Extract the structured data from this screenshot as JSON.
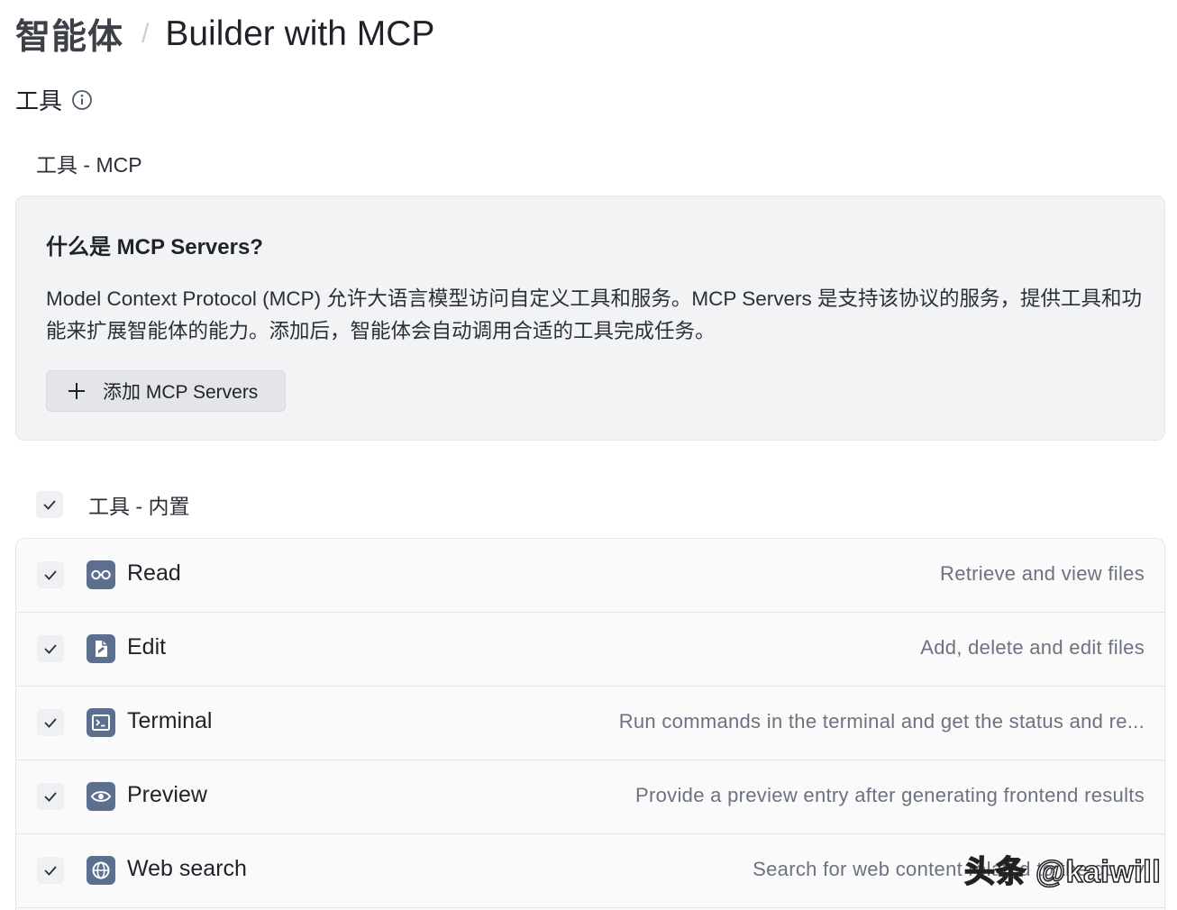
{
  "breadcrumb": {
    "root": "智能体",
    "separator": "/",
    "current": "Builder with MCP"
  },
  "tools_section": {
    "title": "工具",
    "info_icon": "info-circle-icon"
  },
  "mcp": {
    "subtitle": "工具 - MCP",
    "card_title": "什么是 MCP Servers?",
    "card_desc": "Model Context Protocol (MCP) 允许大语言模型访问自定义工具和服务。MCP Servers 是支持该协议的服务，提供工具和功能来扩展智能体的能力。添加后，智能体会自动调用合适的工具完成任务。",
    "add_button": "添加 MCP Servers"
  },
  "builtin": {
    "label": "工具 - 内置",
    "checked": true,
    "tools": [
      {
        "name": "Read",
        "desc": "Retrieve and view files",
        "icon": "glasses-icon",
        "checked": true
      },
      {
        "name": "Edit",
        "desc": "Add, delete and edit files",
        "icon": "edit-file-icon",
        "checked": true
      },
      {
        "name": "Terminal",
        "desc": "Run commands in the terminal and get the status and re...",
        "icon": "terminal-icon",
        "checked": true
      },
      {
        "name": "Preview",
        "desc": "Provide a preview entry after generating frontend results",
        "icon": "eye-icon",
        "checked": true
      },
      {
        "name": "Web search",
        "desc": "Search for web content related to the query",
        "icon": "globe-icon",
        "checked": true
      }
    ]
  },
  "watermark": "头条 @kaiwill",
  "colors": {
    "icon_bg": "#5c6f8f",
    "card_bg": "#f2f3f5",
    "text_secondary": "#6b7280"
  }
}
